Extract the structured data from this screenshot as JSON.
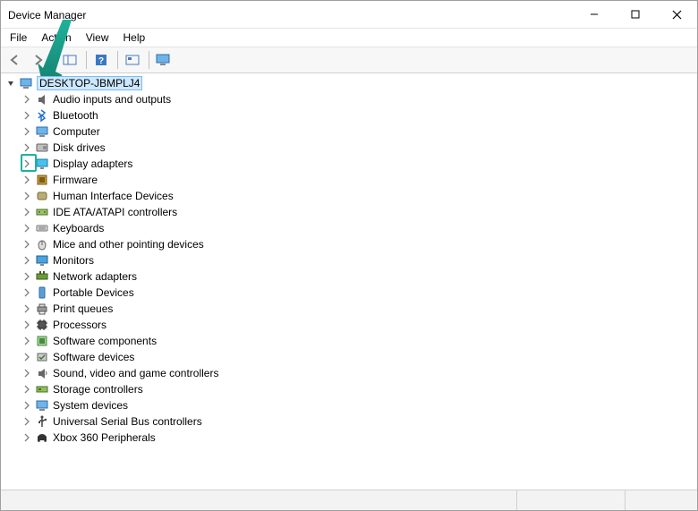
{
  "window": {
    "title": "Device Manager"
  },
  "menubar": {
    "items": [
      "File",
      "Action",
      "View",
      "Help"
    ]
  },
  "tree": {
    "root": {
      "label": "DESKTOP-JBMPLJ4",
      "icon": "computer-icon"
    },
    "categories": [
      {
        "label": "Audio inputs and outputs",
        "icon": "audio-icon"
      },
      {
        "label": "Bluetooth",
        "icon": "bluetooth-icon"
      },
      {
        "label": "Computer",
        "icon": "computer-icon"
      },
      {
        "label": "Disk drives",
        "icon": "disk-icon"
      },
      {
        "label": "Display adapters",
        "icon": "display-icon",
        "highlight": true
      },
      {
        "label": "Firmware",
        "icon": "firmware-icon"
      },
      {
        "label": "Human Interface Devices",
        "icon": "hid-icon"
      },
      {
        "label": "IDE ATA/ATAPI controllers",
        "icon": "ide-icon"
      },
      {
        "label": "Keyboards",
        "icon": "keyboard-icon"
      },
      {
        "label": "Mice and other pointing devices",
        "icon": "mouse-icon"
      },
      {
        "label": "Monitors",
        "icon": "monitor-icon"
      },
      {
        "label": "Network adapters",
        "icon": "network-icon"
      },
      {
        "label": "Portable Devices",
        "icon": "portable-icon"
      },
      {
        "label": "Print queues",
        "icon": "print-icon"
      },
      {
        "label": "Processors",
        "icon": "processor-icon"
      },
      {
        "label": "Software components",
        "icon": "software-component-icon"
      },
      {
        "label": "Software devices",
        "icon": "software-device-icon"
      },
      {
        "label": "Sound, video and game controllers",
        "icon": "sound-icon"
      },
      {
        "label": "Storage controllers",
        "icon": "storage-icon"
      },
      {
        "label": "System devices",
        "icon": "system-icon"
      },
      {
        "label": "Universal Serial Bus controllers",
        "icon": "usb-icon"
      },
      {
        "label": "Xbox 360 Peripherals",
        "icon": "xbox-icon"
      }
    ]
  },
  "annotation": {
    "arrow_color": "#1fb29c",
    "highlight_color": "#1fb29c"
  }
}
